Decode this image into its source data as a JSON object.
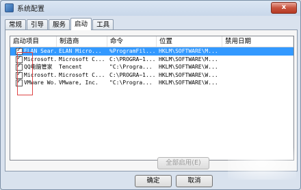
{
  "window": {
    "title": "系统配置",
    "close_label": "x"
  },
  "tabs": [
    {
      "label": "常规"
    },
    {
      "label": "引导"
    },
    {
      "label": "服务"
    },
    {
      "label": "启动"
    },
    {
      "label": "工具"
    }
  ],
  "table": {
    "headers": [
      "启动项目",
      "制造商",
      "命令",
      "位置",
      "禁用日期"
    ],
    "rows": [
      [
        "ELAN Sear...",
        "ELAN Micro...",
        "%ProgramFil...",
        "HKLM\\SOFTWARE\\M...",
        ""
      ],
      [
        "Microsoft...",
        "Microsoft C...",
        "C:\\PROGRA~1...",
        "HKLM\\SOFTWARE\\M...",
        ""
      ],
      [
        "QQ电脑管家",
        "Tencent",
        "\"C:\\Progra...",
        "HKLM\\SOFTWARE\\W...",
        ""
      ],
      [
        "Microsoft...",
        "Microsoft C...",
        "C:\\PROGRA~1...",
        "HKLM\\SOFTWARE\\W...",
        ""
      ],
      [
        "VMware Wo...",
        "VMware, Inc.",
        "\"C:\\Progra...",
        "HKLM\\SOFTWARE\\W...",
        ""
      ]
    ]
  },
  "buttons": {
    "enable_all": "全部启用(E)",
    "ok": "确定",
    "cancel": "取消"
  }
}
